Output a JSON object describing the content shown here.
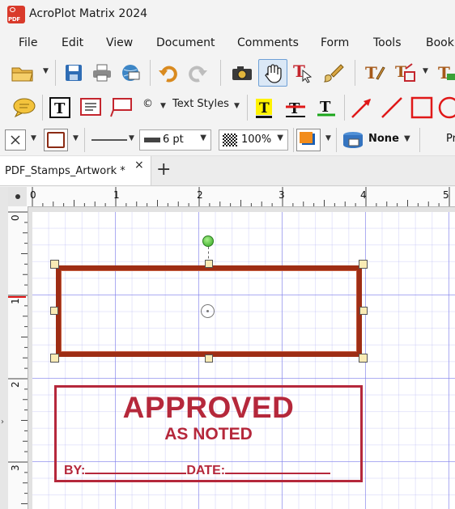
{
  "window": {
    "title": "AcroPlot Matrix 2024",
    "app_icon_text": "PDF"
  },
  "menu": [
    "File",
    "Edit",
    "View",
    "Document",
    "Comments",
    "Form",
    "Tools",
    "Bookm"
  ],
  "toolbar": {
    "symbol_label": "©",
    "text_styles_label": "Text Styles",
    "line_width": "6 pt",
    "opacity": "100%",
    "fill_label": "None",
    "truncated_label": "Pr"
  },
  "tabs": {
    "document_tab": "PDF_Stamps_Artwork *",
    "close_symbol": "×",
    "new_tab_symbol": "+"
  },
  "rulers": {
    "top_numbers": [
      "0",
      "1",
      "2",
      "3",
      "4",
      "5"
    ],
    "left_numbers": [
      "0",
      "1",
      "2",
      "3"
    ]
  },
  "stamp": {
    "title": "APPROVED",
    "subtitle": "AS NOTED",
    "by_label": "BY:",
    "date_label": "DATE:"
  },
  "colors": {
    "selection_border": "#9e2d14",
    "stamp_red": "#b5283b",
    "grid_major": "#7d7deb",
    "handle_fill": "#f9ebb5"
  }
}
